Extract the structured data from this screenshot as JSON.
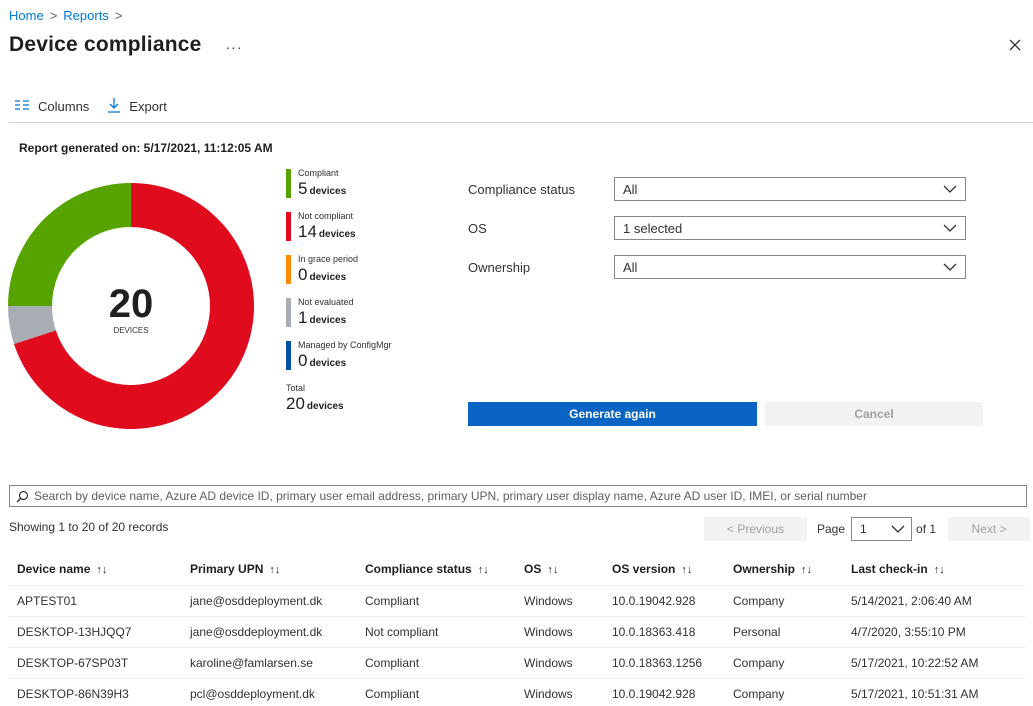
{
  "breadcrumb": {
    "home": "Home",
    "reports": "Reports",
    "separator": ">"
  },
  "page": {
    "title": "Device compliance",
    "more": "···"
  },
  "toolbar": {
    "columns_label": "Columns",
    "export_label": "Export"
  },
  "report_generated": "Report generated on: 5/17/2021, 11:12:05 AM",
  "chart_data": {
    "type": "pie",
    "total": "20",
    "center_label": "DEVICES",
    "slices": [
      {
        "name": "Compliant",
        "value": 5,
        "color": "#57a300"
      },
      {
        "name": "Not compliant",
        "value": 14,
        "color": "#e00b1c"
      },
      {
        "name": "In grace period",
        "value": 0,
        "color": "#ff8c00"
      },
      {
        "name": "Not evaluated",
        "value": 1,
        "color": "#a7adb3"
      },
      {
        "name": "Managed by ConfigMgr",
        "value": 0,
        "color": "#0050a8"
      }
    ]
  },
  "legend": {
    "items": [
      {
        "name": "Compliant",
        "count": "5",
        "unit": "devices",
        "color": "#57a300"
      },
      {
        "name": "Not compliant",
        "count": "14",
        "unit": "devices",
        "color": "#e00b1c"
      },
      {
        "name": "In grace period",
        "count": "0",
        "unit": "devices",
        "color": "#ff8c00"
      },
      {
        "name": "Not evaluated",
        "count": "1",
        "unit": "devices",
        "color": "#a7adb3"
      },
      {
        "name": "Managed by ConfigMgr",
        "count": "0",
        "unit": "devices",
        "color": "#0050a8"
      }
    ],
    "total": {
      "name": "Total",
      "count": "20",
      "unit": "devices"
    }
  },
  "filters": [
    {
      "label": "Compliance status",
      "value": "All"
    },
    {
      "label": "OS",
      "value": "1 selected"
    },
    {
      "label": "Ownership",
      "value": "All"
    }
  ],
  "actions": {
    "generate": "Generate again",
    "cancel": "Cancel"
  },
  "search": {
    "placeholder": "Search by device name, Azure AD device ID, primary user email address, primary UPN, primary user display name, Azure AD user ID, IMEI, or serial number"
  },
  "paging": {
    "showing": "Showing 1 to 20 of 20 records",
    "previous": "< Previous",
    "page_label": "Page",
    "page_value": "1",
    "of": "of 1",
    "next": "Next >"
  },
  "table": {
    "sort_glyph": "↑↓",
    "columns": [
      "Device name",
      "Primary UPN",
      "Compliance status",
      "OS",
      "OS version",
      "Ownership",
      "Last check-in"
    ],
    "rows": [
      [
        "APTEST01",
        "jane@osddeployment.dk",
        "Compliant",
        "Windows",
        "10.0.19042.928",
        "Company",
        "5/14/2021, 2:06:40 AM"
      ],
      [
        "DESKTOP-13HJQQ7",
        "jane@osddeployment.dk",
        "Not compliant",
        "Windows",
        "10.0.18363.418",
        "Personal",
        "4/7/2020, 3:55:10 PM"
      ],
      [
        "DESKTOP-67SP03T",
        "karoline@famlarsen.se",
        "Compliant",
        "Windows",
        "10.0.18363.1256",
        "Company",
        "5/17/2021, 10:22:52 AM"
      ],
      [
        "DESKTOP-86N39H3",
        "pcl@osddeployment.dk",
        "Compliant",
        "Windows",
        "10.0.19042.928",
        "Company",
        "5/17/2021, 10:51:31 AM"
      ]
    ]
  }
}
